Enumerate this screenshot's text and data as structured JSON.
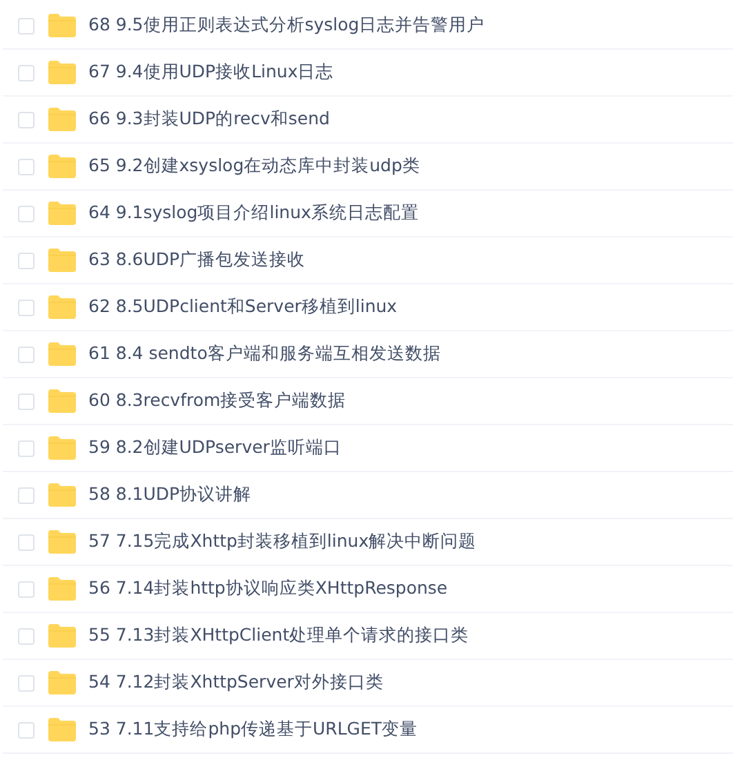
{
  "files": [
    {
      "name": "68 9.5使用正则表达式分析syslog日志并告警用户",
      "checked": false
    },
    {
      "name": "67 9.4使用UDP接收Linux日志",
      "checked": false
    },
    {
      "name": "66 9.3封装UDP的recv和send",
      "checked": false
    },
    {
      "name": "65 9.2创建xsyslog在动态库中封装udp类",
      "checked": false
    },
    {
      "name": "64 9.1syslog项目介绍linux系统日志配置",
      "checked": false
    },
    {
      "name": "63 8.6UDP广播包发送接收",
      "checked": false
    },
    {
      "name": "62 8.5UDPclient和Server移植到linux",
      "checked": false
    },
    {
      "name": "61 8.4 sendto客户端和服务端互相发送数据",
      "checked": false
    },
    {
      "name": "60 8.3recvfrom接受客户端数据",
      "checked": false
    },
    {
      "name": "59 8.2创建UDPserver监听端口",
      "checked": false
    },
    {
      "name": "58 8.1UDP协议讲解",
      "checked": false
    },
    {
      "name": "57 7.15完成Xhttp封装移植到linux解决中断问题",
      "checked": false
    },
    {
      "name": "56 7.14封装http协议响应类XHttpResponse",
      "checked": false
    },
    {
      "name": "55 7.13封装XHttpClient处理单个请求的接口类",
      "checked": false
    },
    {
      "name": "54 7.12封装XhttpServer对外接口类",
      "checked": false
    },
    {
      "name": "53 7.11支持给php传递基于URLGET变量",
      "checked": false
    }
  ]
}
